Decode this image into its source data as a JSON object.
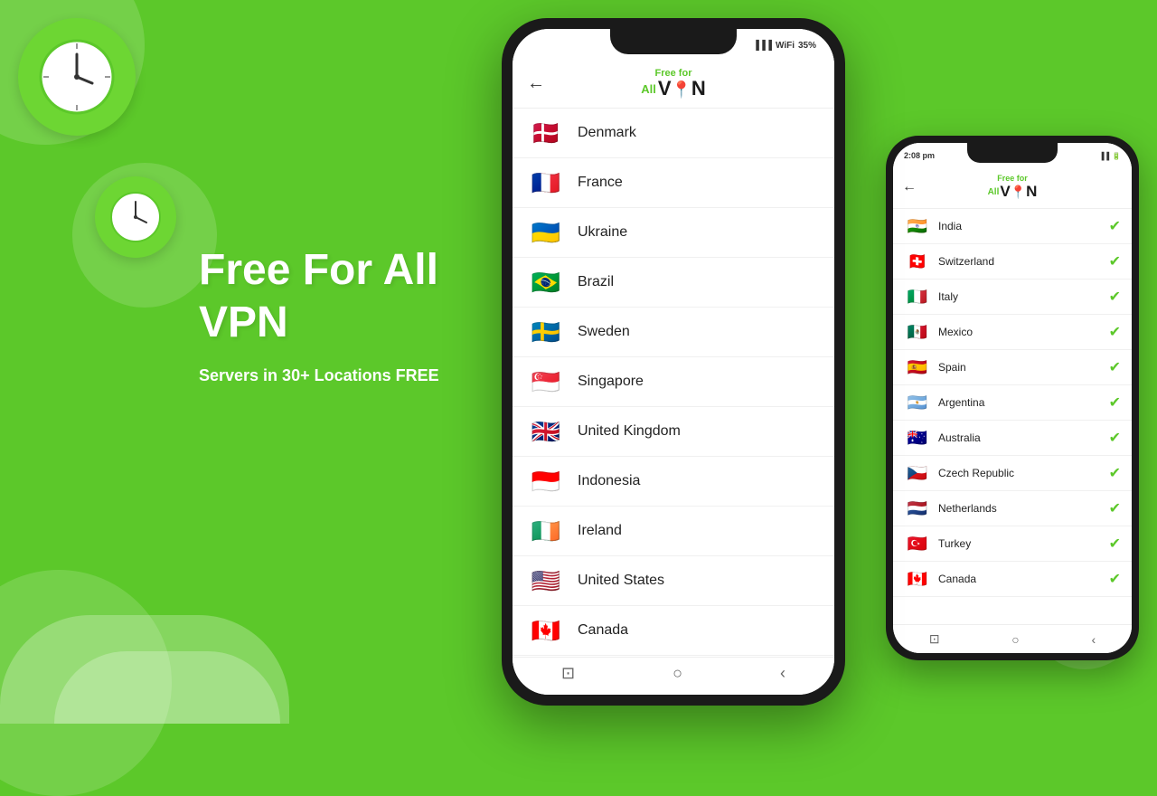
{
  "background": {
    "color": "#5cc82a"
  },
  "left_content": {
    "title_line1": "Free For All",
    "title_line2": "VPN",
    "subtitle": "Servers in 30+ Locations FREE"
  },
  "main_phone": {
    "status_time": "",
    "status_battery": "35%",
    "header": {
      "logo_free": "Free for",
      "logo_all": "All",
      "logo_vpn": "VPN"
    },
    "countries": [
      {
        "name": "Denmark",
        "flag": "🇩🇰"
      },
      {
        "name": "France",
        "flag": "🇫🇷"
      },
      {
        "name": "Ukraine",
        "flag": "🇺🇦"
      },
      {
        "name": "Brazil",
        "flag": "🇧🇷"
      },
      {
        "name": "Sweden",
        "flag": "🇸🇪"
      },
      {
        "name": "Singapore",
        "flag": "🇸🇬"
      },
      {
        "name": "United Kingdom",
        "flag": "🇬🇧"
      },
      {
        "name": "Indonesia",
        "flag": "🇮🇩"
      },
      {
        "name": "Ireland",
        "flag": "🇮🇪"
      },
      {
        "name": "United States",
        "flag": "🇺🇸"
      },
      {
        "name": "Canada",
        "flag": "🇨🇦"
      }
    ]
  },
  "secondary_phone": {
    "status_time": "2:08 pm",
    "header": {
      "logo_free": "Free for",
      "logo_all": "All",
      "logo_vpn": "VPN"
    },
    "countries": [
      {
        "name": "India",
        "flag": "🇮🇳"
      },
      {
        "name": "Switzerland",
        "flag": "🇨🇭"
      },
      {
        "name": "Italy",
        "flag": "🇮🇹"
      },
      {
        "name": "Mexico",
        "flag": "🇲🇽"
      },
      {
        "name": "Spain",
        "flag": "🇪🇸"
      },
      {
        "name": "Argentina",
        "flag": "🇦🇷"
      },
      {
        "name": "Australia",
        "flag": "🇦🇺"
      },
      {
        "name": "Czech Republic",
        "flag": "🇨🇿"
      },
      {
        "name": "Netherlands",
        "flag": "🇳🇱"
      },
      {
        "name": "Turkey",
        "flag": "🇹🇷"
      },
      {
        "name": "Canada",
        "flag": "🇨🇦"
      }
    ]
  }
}
